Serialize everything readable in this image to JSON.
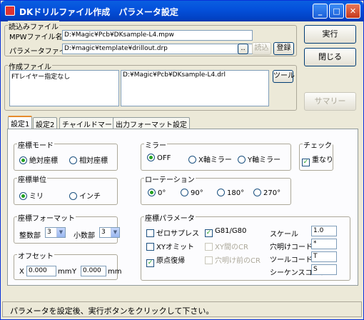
{
  "window": {
    "title": "DKドリルファイル作成　パラメータ設定"
  },
  "read_file": {
    "group_label": "読込みファイル",
    "mpw_label": "MPWファイル名",
    "mpw_value": "D:¥Magic¥Pcb¥DKsample-L4.mpw",
    "param_label": "パラメータファイル名",
    "param_value": "D:¥magic¥template¥drillout.drp",
    "browse_label": "..",
    "load_label": "読込",
    "register_label": "登録"
  },
  "buttons": {
    "run": "実行",
    "close": "閉じる",
    "summary": "サマリー"
  },
  "create_file": {
    "group_label": "作成ファイル",
    "list_left": "FTレイヤー指定なし",
    "list_right": "D:¥Magic¥Pcb¥DKsample-L4.drl",
    "tool_button": "ツール"
  },
  "tabs": [
    "設定1",
    "設定2",
    "チャイルドマーク",
    "出力フォーマット設定"
  ],
  "coord_mode": {
    "label": "座標モード",
    "options": [
      "絶対座標",
      "相対座標"
    ]
  },
  "mirror": {
    "label": "ミラー",
    "options": [
      "OFF",
      "X軸ミラー",
      "Y軸ミラー"
    ]
  },
  "check": {
    "label": "チェック",
    "option": "重なり"
  },
  "units": {
    "label": "座標単位",
    "options": [
      "ミリ",
      "インチ"
    ]
  },
  "rotation": {
    "label": "ローテーション",
    "options": [
      "0°",
      "90°",
      "180°",
      "270°"
    ]
  },
  "coord_format": {
    "label": "座標フォーマット",
    "int_label": "整数部",
    "int_value": "3",
    "dec_label": "小数部",
    "dec_value": "3"
  },
  "offset": {
    "label": "オフセット",
    "x_label": "X",
    "x_value": "0.000",
    "x_unit": "mm",
    "y_label": "Y",
    "y_value": "0.000",
    "y_unit": "mm"
  },
  "coord_params": {
    "label": "座標パラメータ",
    "zero_suppress": "ゼロサプレス",
    "g81_g80": "G81/G80",
    "xy_omit": "XYオミット",
    "xy_cr": "XY間のCR",
    "origin_return": "原点復帰",
    "before_drill_cr": "穴明け前のCR",
    "scale_label": "スケール",
    "scale_value": "1.0",
    "drill_code_label": "穴明けコード",
    "drill_code_value": "*",
    "tool_code_label": "ツールコード",
    "tool_code_value": "T",
    "seq_code_label": "シーケンスコード",
    "seq_code_value": "S"
  },
  "status": {
    "message": "パラメータを設定後、実行ボタンをクリックして下さい。"
  }
}
